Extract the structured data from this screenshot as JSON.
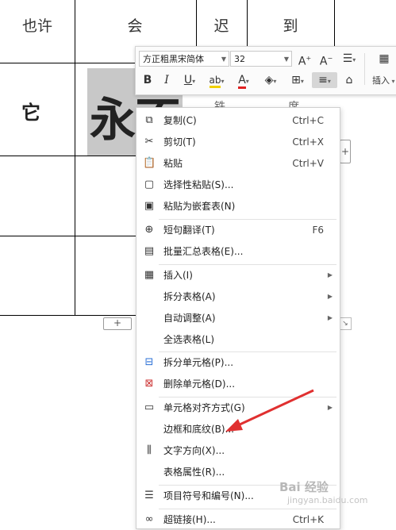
{
  "table": {
    "header": [
      "也许",
      "会",
      "迟",
      "到"
    ],
    "row1_first": "它",
    "selected_chars": [
      "永",
      "不"
    ],
    "row1_hidden": [
      "铁",
      "席"
    ],
    "add_row_symbol": "+",
    "add_col_symbol": "+"
  },
  "toolbar": {
    "font_name": "方正粗黑宋简体",
    "font_size": "32",
    "grow_font": "A",
    "shrink_font": "A",
    "bold": "B",
    "italic": "I",
    "underline": "U",
    "highlight": "ab",
    "font_color": "A",
    "insert_label": "插入"
  },
  "menu": {
    "items": [
      {
        "label": "复制(C)",
        "shortcut": "Ctrl+C",
        "icon": "copy-icon"
      },
      {
        "label": "剪切(T)",
        "shortcut": "Ctrl+X",
        "icon": "scissors-icon"
      },
      {
        "label": "粘贴",
        "shortcut": "Ctrl+V",
        "icon": "paste-icon"
      },
      {
        "label": "选择性粘贴(S)...",
        "shortcut": "",
        "icon": "paste-special-icon"
      },
      {
        "label": "粘贴为嵌套表(N)",
        "shortcut": "",
        "icon": "paste-nested-table-icon"
      },
      {
        "label": "短句翻译(T)",
        "shortcut": "F6",
        "icon": "translate-icon"
      },
      {
        "label": "批量汇总表格(E)...",
        "shortcut": "",
        "icon": "batch-summary-icon"
      },
      {
        "label": "插入(I)",
        "shortcut": "",
        "icon": "table-insert-icon",
        "submenu": true
      },
      {
        "label": "拆分表格(A)",
        "shortcut": "",
        "icon": "",
        "submenu": true
      },
      {
        "label": "自动调整(A)",
        "shortcut": "",
        "icon": "",
        "submenu": true
      },
      {
        "label": "全选表格(L)",
        "shortcut": "",
        "icon": ""
      },
      {
        "label": "拆分单元格(P)...",
        "shortcut": "",
        "icon": "split-cells-icon"
      },
      {
        "label": "删除单元格(D)...",
        "shortcut": "",
        "icon": "delete-cells-icon"
      },
      {
        "label": "单元格对齐方式(G)",
        "shortcut": "",
        "icon": "cell-align-icon",
        "submenu": true
      },
      {
        "label": "边框和底纹(B)...",
        "shortcut": "",
        "icon": ""
      },
      {
        "label": "文字方向(X)...",
        "shortcut": "",
        "icon": "text-direction-icon"
      },
      {
        "label": "表格属性(R)...",
        "shortcut": "",
        "icon": ""
      },
      {
        "label": "项目符号和编号(N)...",
        "shortcut": "",
        "icon": "bullets-icon"
      },
      {
        "label": "超链接(H)...",
        "shortcut": "Ctrl+K",
        "icon": "hyperlink-icon"
      }
    ]
  },
  "annotation": {
    "arrow_color": "#e03030"
  },
  "watermark": {
    "text": "Bai 经验",
    "sub": "jingyan.baidu.com"
  }
}
